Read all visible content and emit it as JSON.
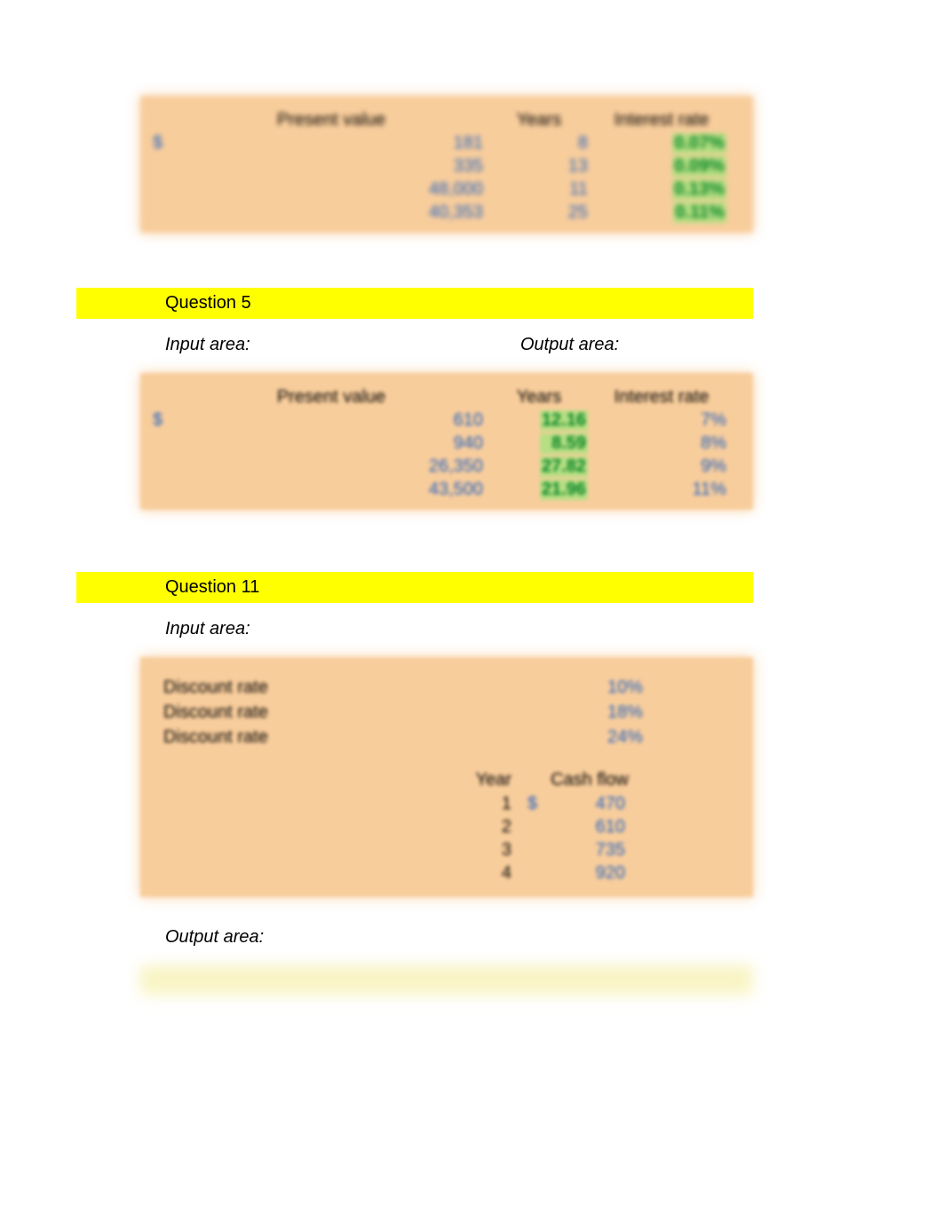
{
  "table1": {
    "headers": {
      "pv": "Present value",
      "years": "Years",
      "rate": "Interest rate"
    },
    "dollar": "$",
    "rows": [
      {
        "pv": "181",
        "years": "8",
        "rate": "0.07%"
      },
      {
        "pv": "335",
        "years": "13",
        "rate": "0.09%"
      },
      {
        "pv": "48,000",
        "years": "11",
        "rate": "0.13%"
      },
      {
        "pv": "40,353",
        "years": "25",
        "rate": "0.11%"
      }
    ]
  },
  "q5": {
    "title": "Question 5",
    "input_label": "Input area:",
    "output_label": "Output area:",
    "headers": {
      "pv": "Present value",
      "years": "Years",
      "rate": "Interest rate"
    },
    "dollar": "$",
    "rows": [
      {
        "pv": "610",
        "years": "12.16",
        "rate": "7%"
      },
      {
        "pv": "940",
        "years": "8.59",
        "rate": "8%"
      },
      {
        "pv": "26,350",
        "years": "27.82",
        "rate": "9%"
      },
      {
        "pv": "43,500",
        "years": "21.96",
        "rate": "11%"
      }
    ]
  },
  "q11": {
    "title": "Question 11",
    "input_label": "Input area:",
    "output_label": "Output area:",
    "discount_label": "Discount rate",
    "discount_rates": [
      "10%",
      "18%",
      "24%"
    ],
    "cash_header": {
      "year": "Year",
      "cf": "Cash flow"
    },
    "dollar": "$",
    "cashflows": [
      {
        "year": "1",
        "val": "470",
        "show_dollar": true
      },
      {
        "year": "2",
        "val": "610",
        "show_dollar": false
      },
      {
        "year": "3",
        "val": "735",
        "show_dollar": false
      },
      {
        "year": "4",
        "val": "920",
        "show_dollar": false
      }
    ]
  }
}
